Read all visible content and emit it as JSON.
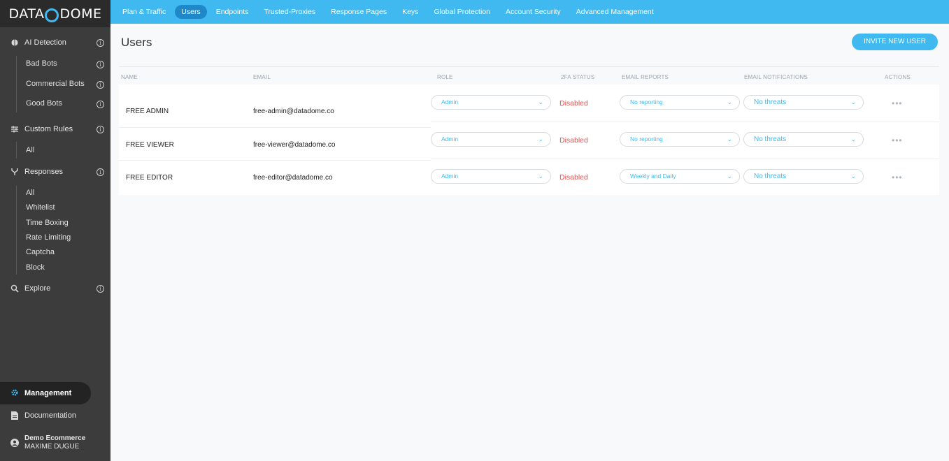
{
  "brand": {
    "logo_text_left": "DATA",
    "logo_text_right": "DOME"
  },
  "sidebar": {
    "ai_detection": {
      "label": "AI Detection",
      "info": "i"
    },
    "bad_bots": "Bad Bots",
    "commercial_bots": "Commercial Bots",
    "good_bots": "Good Bots",
    "custom_rules": {
      "label": "Custom Rules",
      "info": "i"
    },
    "custom_rules_all": "All",
    "responses": {
      "label": "Responses",
      "info": "i"
    },
    "responses_items": [
      "All",
      "Whitelist",
      "Time Boxing",
      "Rate Limiting",
      "Captcha",
      "Block"
    ],
    "explore": {
      "label": "Explore",
      "info": "i"
    },
    "management": "Management",
    "documentation": "Documentation",
    "account": {
      "org": "Demo Ecommerce",
      "user": "MAXIME DUGUE"
    }
  },
  "topnav": {
    "tabs": [
      "Plan & Traffic",
      "Users",
      "Endpoints",
      "Trusted-Proxies",
      "Response Pages",
      "Keys",
      "Global Protection",
      "Account Security",
      "Advanced Management"
    ],
    "active": "Users"
  },
  "page": {
    "title": "Users",
    "invite_button": "INVITE NEW USER"
  },
  "table": {
    "columns": {
      "name": "NAME",
      "email": "EMAIL",
      "role": "ROLE",
      "twofa": "2FA STATUS",
      "email_reports": "EMAIL REPORTS",
      "email_notifications": "EMAIL NOTIFICATIONS",
      "actions": "ACTIONS"
    },
    "rows": [
      {
        "name": "FREE ADMIN",
        "email": "free-admin@datadome.co",
        "role": "Admin",
        "twofa": "Disabled",
        "reports": "No reporting",
        "notifications": "No threats",
        "actions": "•••"
      },
      {
        "name": "FREE VIEWER",
        "email": "free-viewer@datadome.co",
        "role": "Admin",
        "twofa": "Disabled",
        "reports": "No reporting",
        "notifications": "No threats",
        "actions": "•••"
      },
      {
        "name": "FREE EDITOR",
        "email": "free-editor@datadome.co",
        "role": "Admin",
        "twofa": "Disabled",
        "reports": "Weekly and Daily",
        "notifications": "No threats",
        "actions": "•••"
      }
    ]
  },
  "colors": {
    "accent": "#3fb9f0",
    "sidebar_bg": "#3c3c3c",
    "danger": "#e05252"
  },
  "icons": {
    "ai_detection": "brain-icon",
    "custom_rules": "sliders-icon",
    "responses": "fork-icon",
    "explore": "search-icon",
    "management": "gear-icon",
    "documentation": "file-icon",
    "account": "user-icon",
    "chevron": "chevron-down-icon"
  }
}
